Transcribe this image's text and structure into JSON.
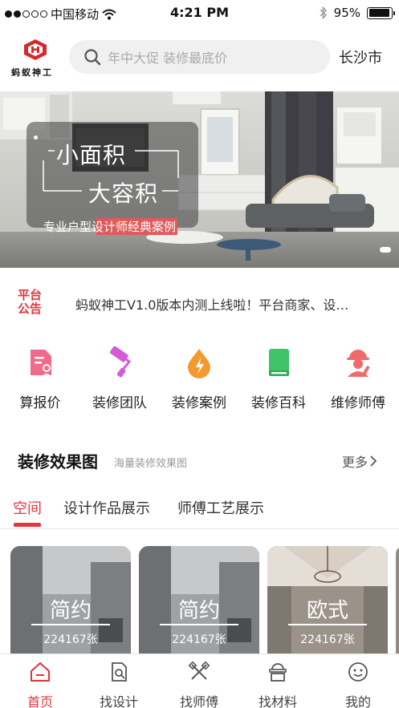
{
  "status_bar": {
    "carrier": "中国移动",
    "time": "4:21 PM",
    "battery": "95%",
    "battery_level": 0.95
  },
  "header": {
    "logo_text": "蚂蚁神工",
    "search_placeholder": "年中大促 装修最底价",
    "city": "长沙市"
  },
  "banner": {
    "line1": "小面积",
    "line2": "大容积",
    "tagline": "专业户型设计师经典案例",
    "slides_current": 2
  },
  "notice": {
    "badge": "平台公告",
    "text": "蚂蚁神工V1.0版本内测上线啦！平台商家、设…"
  },
  "quick_menu": [
    {
      "label": "算报价",
      "icon": "quote-icon",
      "color": "#f06a8a"
    },
    {
      "label": "装修团队",
      "icon": "paint-roller-icon",
      "color": "#d45bd6"
    },
    {
      "label": "装修案例",
      "icon": "fire-drop-icon",
      "color": "#f49a2d"
    },
    {
      "label": "装修百科",
      "icon": "book-icon",
      "color": "#3fc36b"
    },
    {
      "label": "维修师傅",
      "icon": "worker-icon",
      "color": "#f06a6a"
    }
  ],
  "section": {
    "title": "装修效果图",
    "subtitle": "海量装修效果图",
    "more": "更多"
  },
  "tabs": [
    {
      "label": "空间",
      "active": true
    },
    {
      "label": "设计作品展示",
      "active": false
    },
    {
      "label": "师傅工艺展示",
      "active": false
    }
  ],
  "cards": [
    {
      "style": "简约",
      "count": "224167张"
    },
    {
      "style": "简约",
      "count": "224167张"
    },
    {
      "style": "欧式",
      "count": "224167张"
    }
  ],
  "tabbar": [
    {
      "label": "首页",
      "icon": "home-icon",
      "active": true
    },
    {
      "label": "找设计",
      "icon": "design-search-icon",
      "active": false
    },
    {
      "label": "找师傅",
      "icon": "tools-icon",
      "active": false
    },
    {
      "label": "找材料",
      "icon": "materials-icon",
      "active": false
    },
    {
      "label": "我的",
      "icon": "profile-icon",
      "active": false
    }
  ],
  "colors": {
    "accent": "#e5343c",
    "search_bg": "#f0f0f0"
  }
}
